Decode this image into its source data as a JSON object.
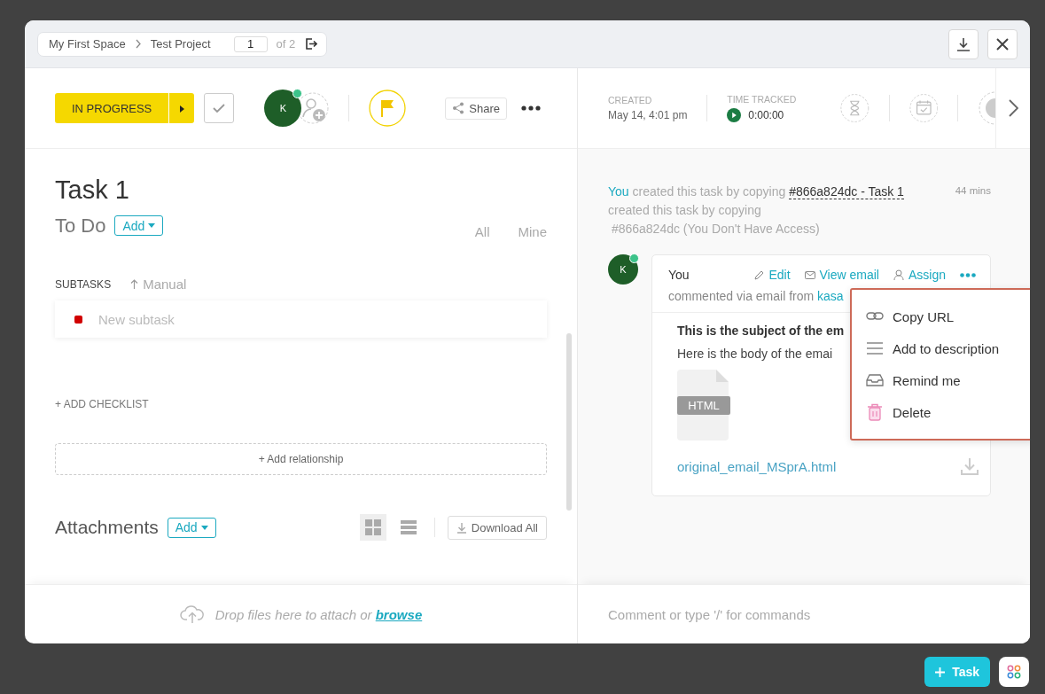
{
  "breadcrumb": {
    "items": [
      "My First Space",
      "Test Project"
    ],
    "page": "1",
    "of": "of 2"
  },
  "toolbar": {
    "status": "IN PROGRESS",
    "avatar": "K",
    "share": "Share"
  },
  "meta": {
    "created_label": "CREATED",
    "created": "May 14, 4:01 pm",
    "time_label": "TIME TRACKED",
    "time": "0:00:00"
  },
  "task": {
    "title": "Task 1",
    "status": "To Do",
    "add": "Add",
    "filters": [
      "All",
      "Mine"
    ]
  },
  "subtasks": {
    "label": "SUBTASKS",
    "sort": "Manual",
    "placeholder": "New subtask"
  },
  "checklist": "+ ADD CHECKLIST",
  "relationship": "+ Add relationship",
  "attachments": {
    "title": "Attachments",
    "add": "Add",
    "download": "Download All"
  },
  "footer": {
    "drop": "Drop files here to attach or",
    "browse": "browse",
    "comment_placeholder": "Comment or type '/' for commands"
  },
  "activity": {
    "actor": "You",
    "text": "created this task by copying",
    "link": "#866a824dc - Task 1",
    "time": "44 mins",
    "line2": "created this task by copying",
    "line3": "#866a824dc (You Don't Have Access)"
  },
  "comment": {
    "avatar": "K",
    "author": "You",
    "actions": [
      {
        "kind": "edit",
        "label": "Edit"
      },
      {
        "kind": "email",
        "label": "View email"
      },
      {
        "kind": "assign",
        "label": "Assign"
      }
    ],
    "via": "commented via email from",
    "via_link": "kasa",
    "subject": "This is the subject of the em",
    "body": "Here is the body of the emai",
    "file_badge": "HTML",
    "file_name": "original_email_MSprA.html"
  },
  "menu": [
    {
      "kind": "link",
      "label": "Copy URL"
    },
    {
      "kind": "lines",
      "label": "Add to description"
    },
    {
      "kind": "inbox",
      "label": "Remind me"
    },
    {
      "kind": "trash",
      "label": "Delete"
    }
  ],
  "fab": {
    "label": "Task"
  }
}
